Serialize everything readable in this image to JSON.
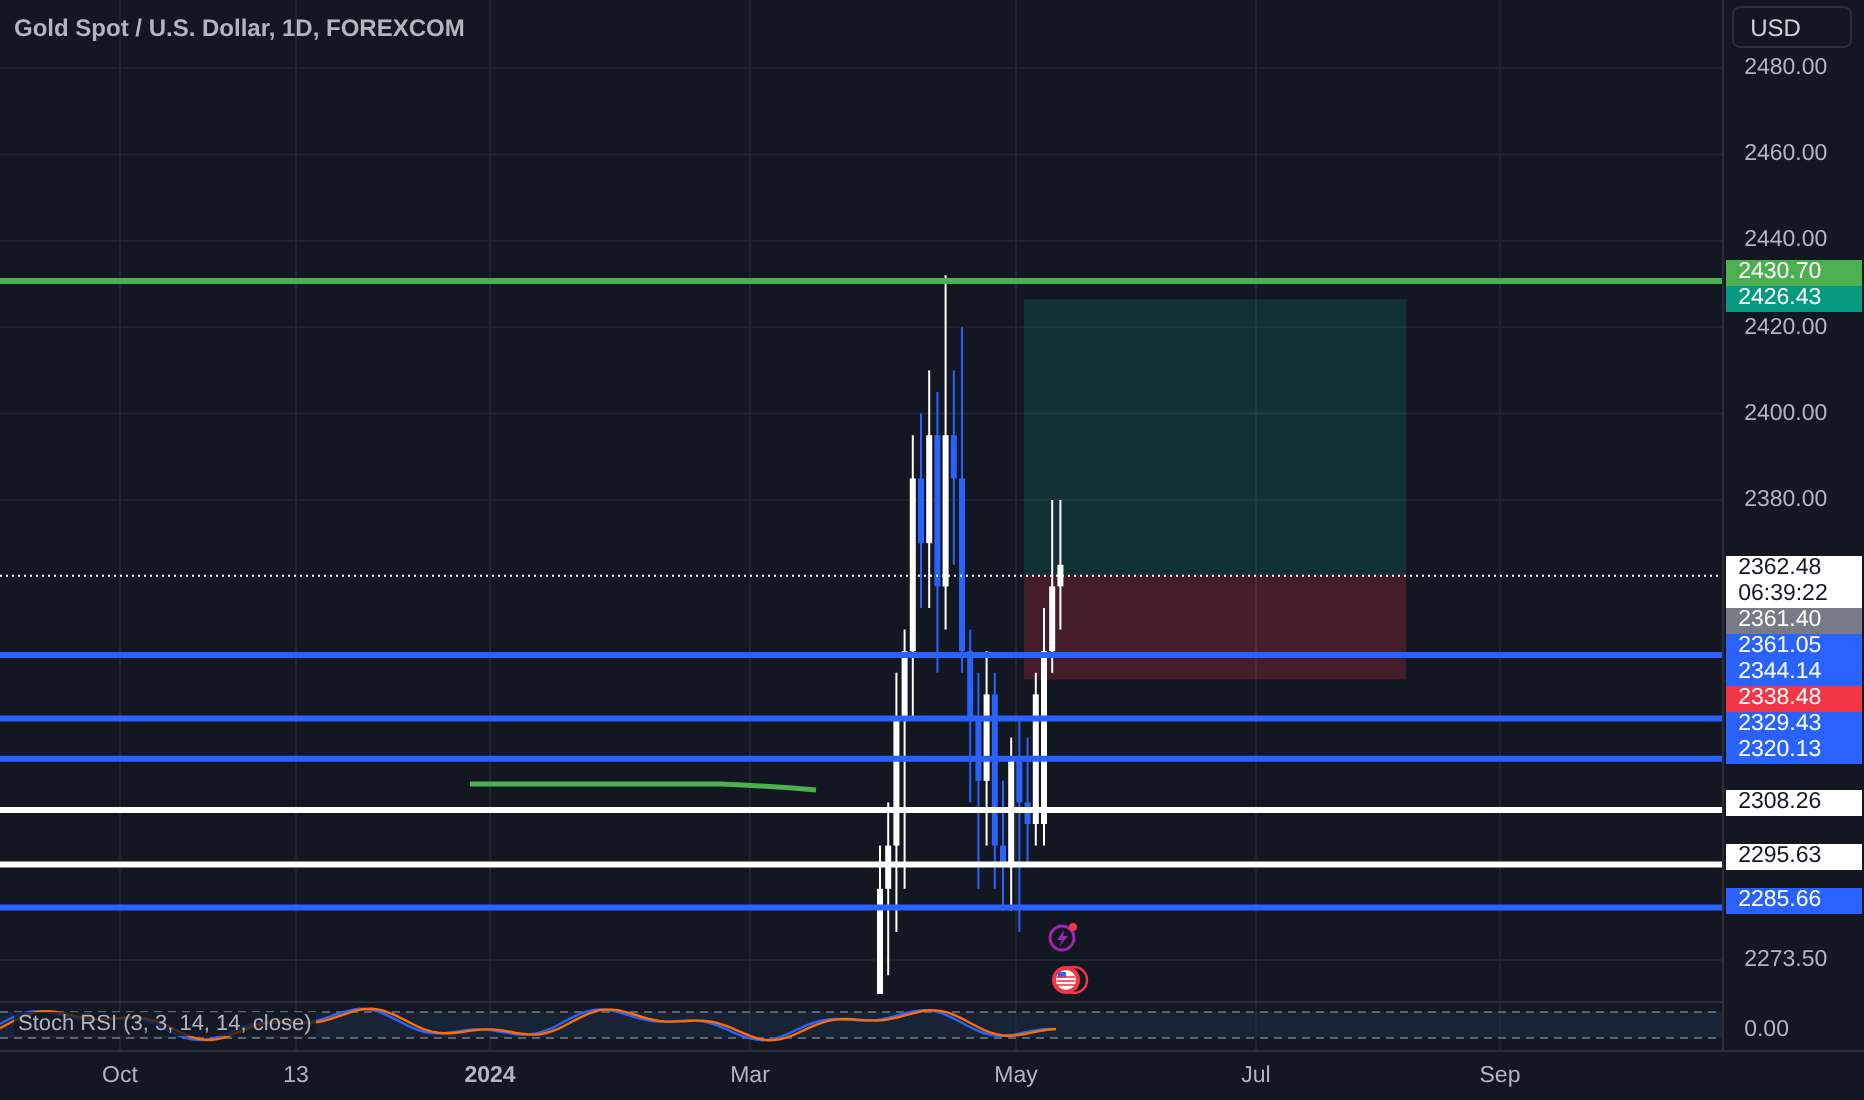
{
  "title": "Gold Spot / U.S. Dollar, 1D, FOREXCOM",
  "currency_button": "USD",
  "price_ticks": [
    "2480.00",
    "2460.00",
    "2440.00",
    "2420.00",
    "2400.00",
    "2380.00",
    "2273.50"
  ],
  "price_labels": [
    {
      "label": "2430.70",
      "color": "#4caf50",
      "kind": "line"
    },
    {
      "label": "2426.43",
      "color": "#089981",
      "kind": "target"
    },
    {
      "label": "2362.48",
      "sublabel": "06:39:22",
      "color": "#ffffff",
      "kind": "price"
    },
    {
      "label": "2361.40",
      "color": "#787b86",
      "kind": "marker"
    },
    {
      "label": "2361.05",
      "color": "#2962ff",
      "kind": "marker"
    },
    {
      "label": "2344.14",
      "color": "#2962ff",
      "kind": "line"
    },
    {
      "label": "2338.48",
      "color": "#f23645",
      "kind": "stop"
    },
    {
      "label": "2329.43",
      "color": "#2962ff",
      "kind": "line"
    },
    {
      "label": "2320.13",
      "color": "#2962ff",
      "kind": "line"
    },
    {
      "label": "2308.26",
      "color": "#ffffff",
      "kind": "line"
    },
    {
      "label": "2295.63",
      "color": "#ffffff",
      "kind": "line"
    },
    {
      "label": "2285.66",
      "color": "#2962ff",
      "kind": "line"
    }
  ],
  "indicator": {
    "label": "Stoch RSI (3, 3, 14, 14, close)",
    "reading": "0.00"
  },
  "time_axis": [
    {
      "label": "Oct",
      "bold": false
    },
    {
      "label": "13",
      "bold": false
    },
    {
      "label": "2024",
      "bold": true
    },
    {
      "label": "Mar",
      "bold": false
    },
    {
      "label": "May",
      "bold": false
    },
    {
      "label": "Jul",
      "bold": false
    },
    {
      "label": "Sep",
      "bold": false
    }
  ]
}
